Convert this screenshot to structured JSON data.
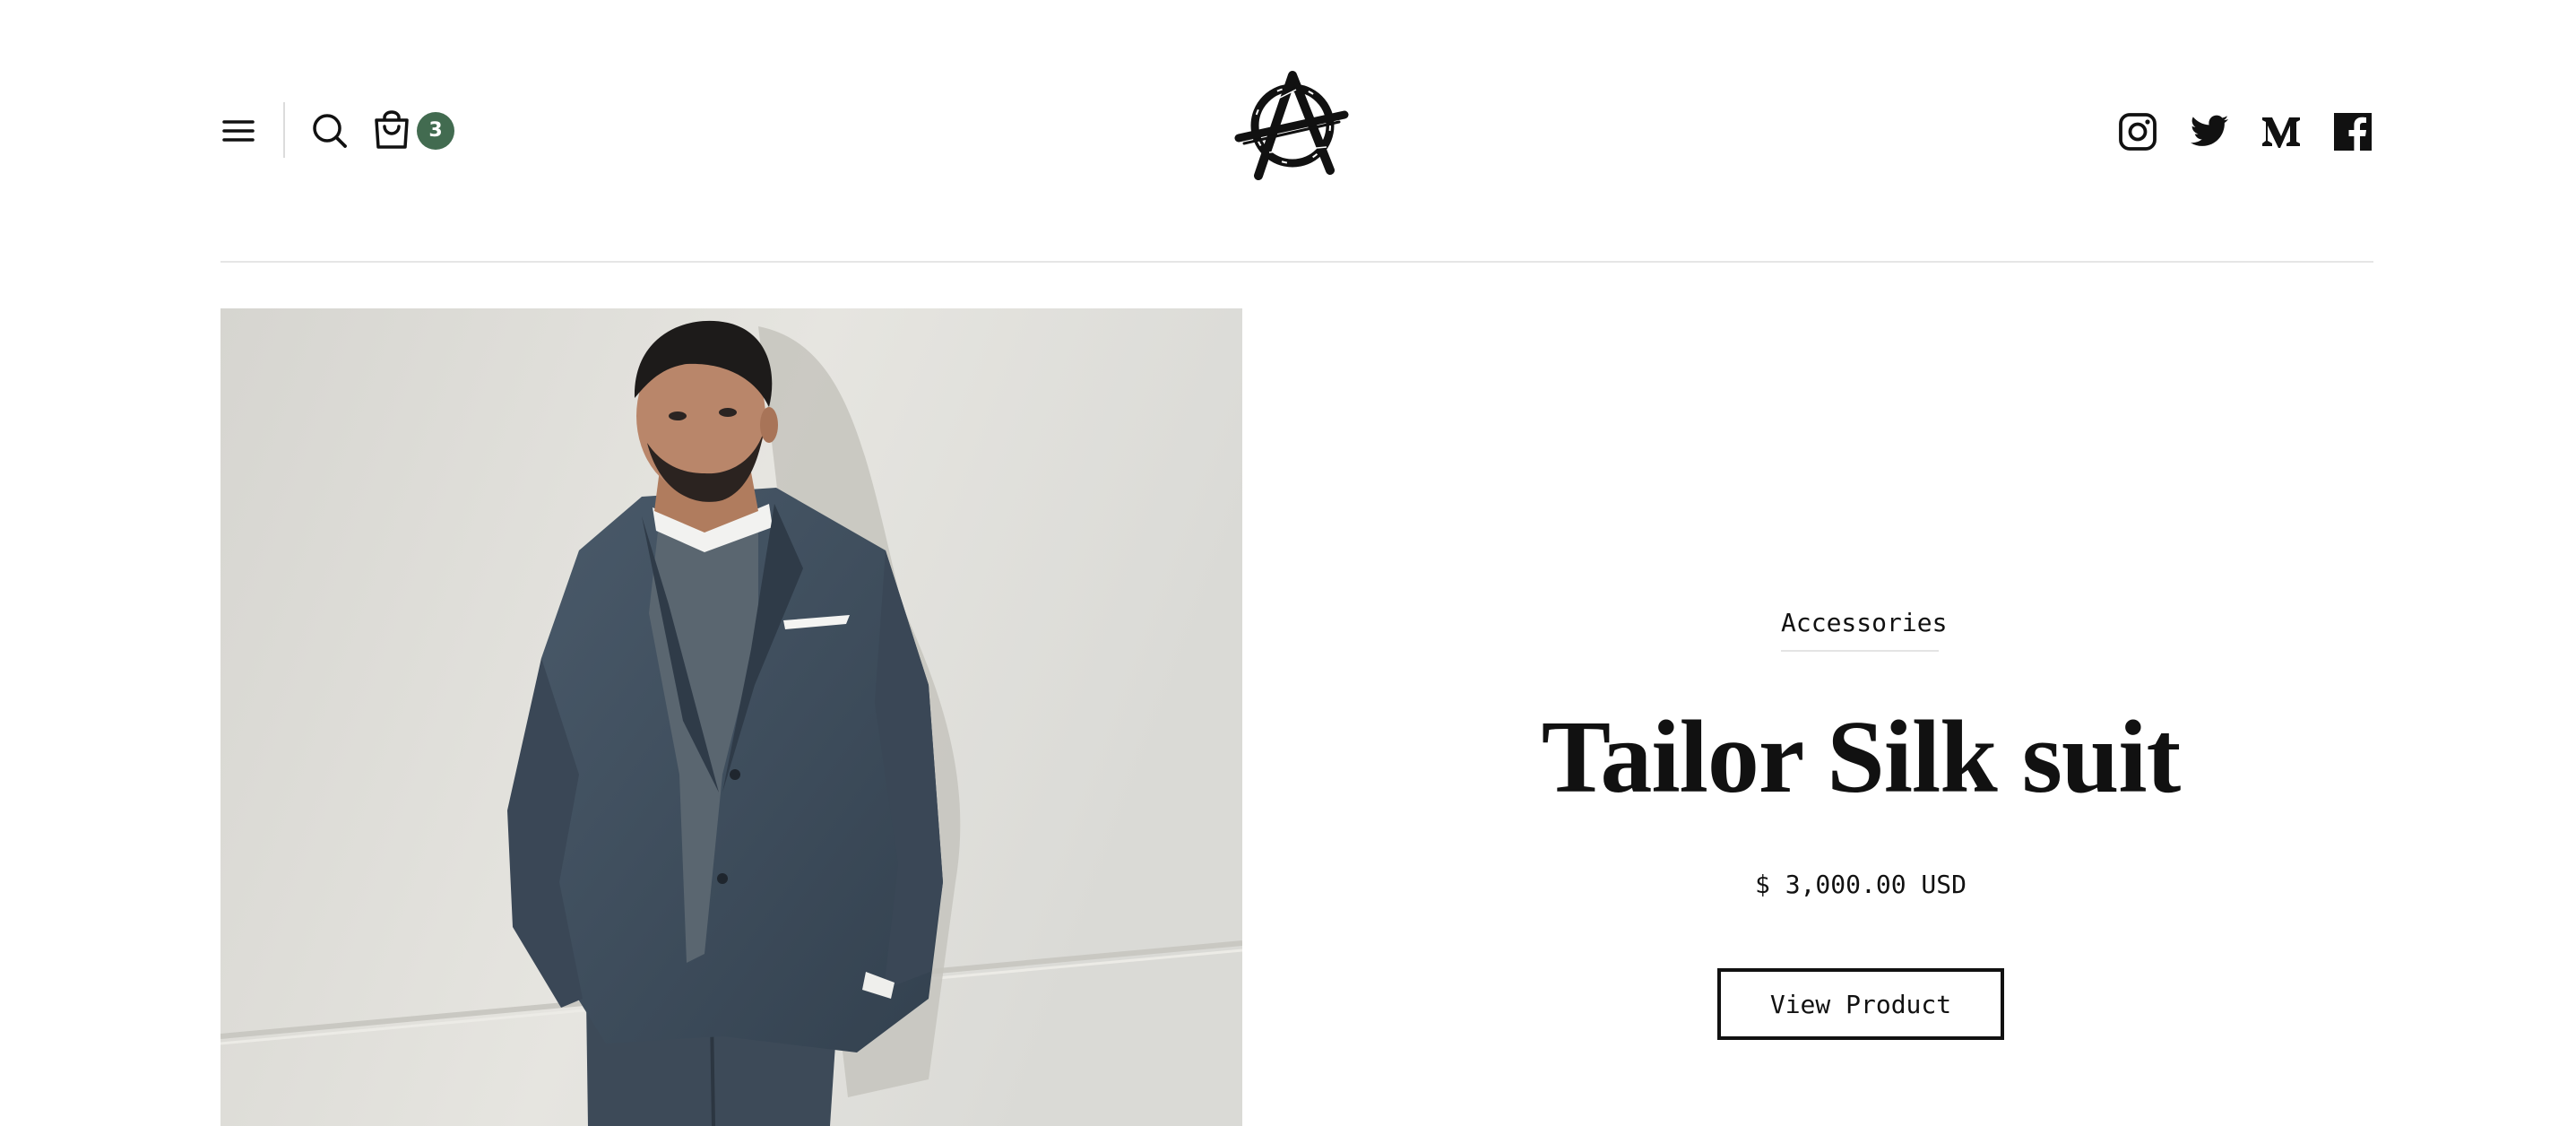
{
  "header": {
    "cart_count": "3",
    "icons": {
      "menu": "menu-icon",
      "search": "search-icon",
      "cart": "shopping-bag-icon",
      "logo": "anarchy-a-logo",
      "instagram": "instagram-icon",
      "twitter": "twitter-icon",
      "medium": "medium-icon",
      "facebook": "facebook-icon"
    },
    "accent_color": "#426b50"
  },
  "product": {
    "category": "Accessories",
    "title": "Tailor Silk suit",
    "price": "$ 3,000.00 USD",
    "button_label": "View Product",
    "image": "man-in-grey-suit-photo"
  }
}
